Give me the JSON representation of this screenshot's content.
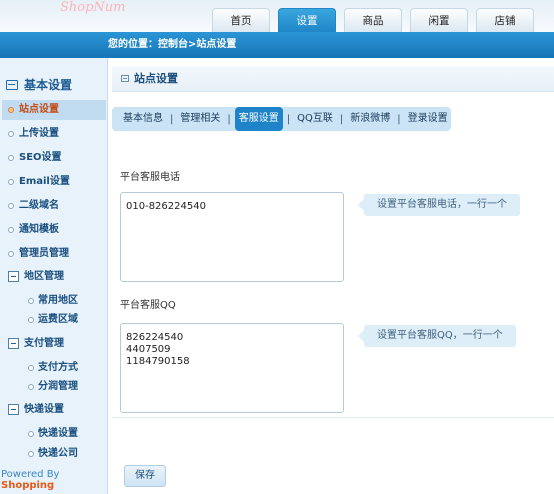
{
  "app": {
    "logo_text": "ShopNum"
  },
  "nav_tabs": [
    {
      "label": "首页"
    },
    {
      "label": "设置"
    },
    {
      "label": "商品"
    },
    {
      "label": "闲置"
    },
    {
      "label": "店铺"
    }
  ],
  "breadcrumb": "您的位置：控制台>站点设置",
  "sidebar": {
    "title": "基本设置",
    "items": [
      {
        "label": "站点设置"
      },
      {
        "label": "上传设置"
      },
      {
        "label": "SEO设置"
      },
      {
        "label": "Email设置"
      },
      {
        "label": "二级域名"
      },
      {
        "label": "通知模板"
      },
      {
        "label": "管理员管理"
      }
    ],
    "groups": [
      {
        "label": "地区管理",
        "items": [
          {
            "label": "常用地区"
          },
          {
            "label": "运费区域"
          }
        ]
      },
      {
        "label": "支付管理",
        "items": [
          {
            "label": "支付方式"
          },
          {
            "label": "分润管理"
          }
        ]
      },
      {
        "label": "快递设置",
        "items": [
          {
            "label": "快递设置"
          },
          {
            "label": "快递公司"
          }
        ]
      }
    ],
    "powered_prefix": "Powered By ",
    "powered_brand": "Shopping"
  },
  "panel": {
    "title": "站点设置"
  },
  "subtabs": [
    {
      "label": "基本信息"
    },
    {
      "label": "管理相关"
    },
    {
      "label": "客服设置"
    },
    {
      "label": "QQ互联"
    },
    {
      "label": "新浪微博"
    },
    {
      "label": "登录设置"
    }
  ],
  "subtab_separator": "|",
  "form": {
    "phone_label": "平台客服电话",
    "phone_value": "010-826224540",
    "phone_hint": "设置平台客服电话，一行一个",
    "qq_label": "平台客服QQ",
    "qq_value": "826224540\n4407509\n1184790158",
    "qq_hint": "设置平台客服QQ，一行一个",
    "save_label": "保存"
  },
  "colors": {
    "accent": "#1e83c8",
    "header_blue": "#2b95d6",
    "active_text": "#c14b12"
  }
}
